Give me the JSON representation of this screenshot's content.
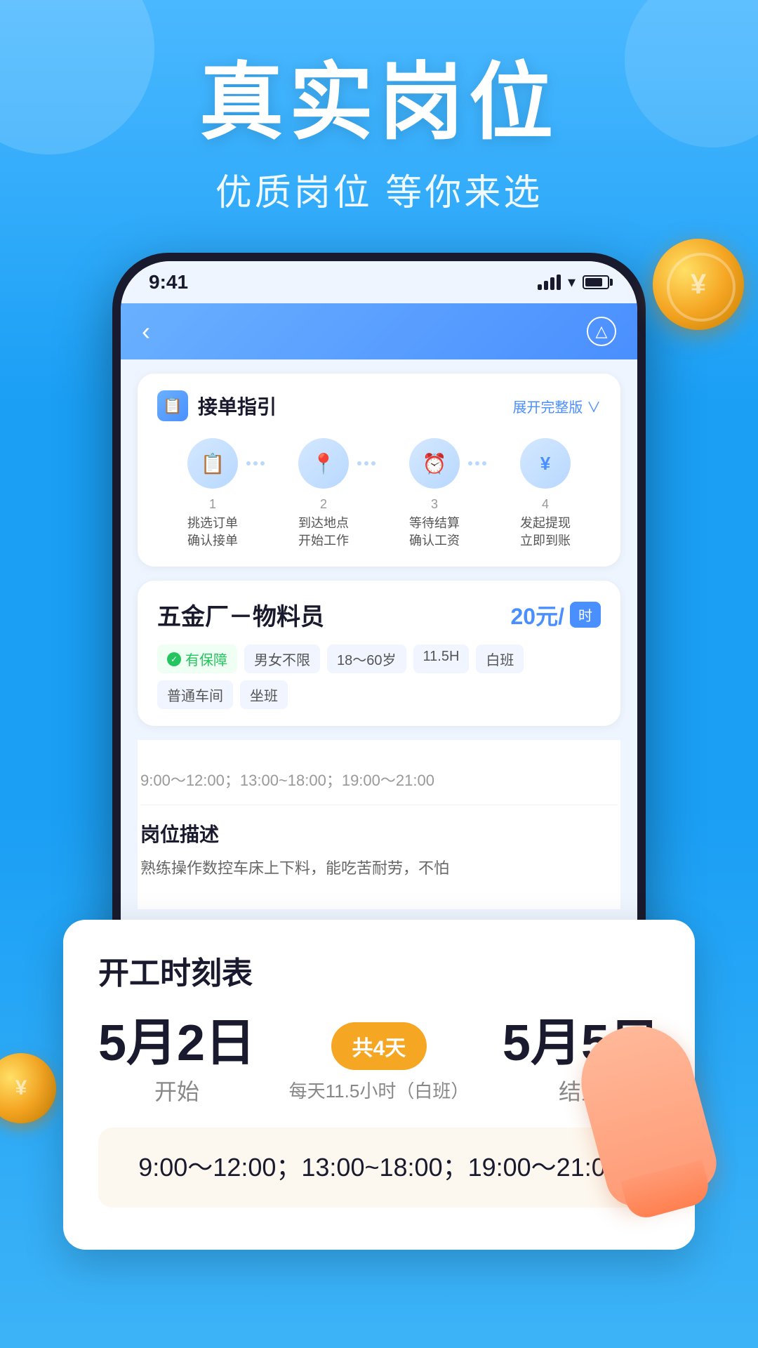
{
  "app": {
    "background_color": "#1a9ff5"
  },
  "header": {
    "main_title": "真实岗位",
    "sub_title": "优质岗位 等你来选"
  },
  "phone": {
    "status_bar": {
      "time": "9:41"
    },
    "guide_card": {
      "title": "接单指引",
      "expand_label": "展开完整版",
      "steps": [
        {
          "number": "1",
          "icon": "📋",
          "line1": "挑选订单",
          "line2": "确认接单"
        },
        {
          "number": "2",
          "icon": "📍",
          "line1": "到达地点",
          "line2": "开始工作"
        },
        {
          "number": "3",
          "icon": "⏰",
          "line1": "等待结算",
          "line2": "确认工资"
        },
        {
          "number": "4",
          "icon": "¥",
          "line1": "发起提现",
          "line2": "立即到账"
        }
      ]
    },
    "job_card": {
      "title": "五金厂－物料员",
      "wage": "20元/",
      "wage_unit": "时",
      "tags": [
        {
          "type": "green",
          "text": "有保障"
        },
        {
          "type": "default",
          "text": "男女不限"
        },
        {
          "type": "default",
          "text": "18～60岁"
        },
        {
          "type": "default",
          "text": "11.5H"
        },
        {
          "type": "default",
          "text": "白班"
        },
        {
          "type": "default",
          "text": "普通车间"
        },
        {
          "type": "default",
          "text": "坐班"
        }
      ]
    }
  },
  "schedule_popup": {
    "title": "开工时刻表",
    "start_date": "5月2日",
    "start_label": "开始",
    "end_date": "5月5日",
    "end_label": "结束",
    "days_badge": "共4天",
    "daily_desc": "每天11.5小时（白班）",
    "times_display": "9:00～12:00；13:00~18:00；19:00～21:00",
    "times_secondary": "9:00～12:00；13:00~18:00；19:00～21:00"
  },
  "job_description": {
    "section_title": "岗位描述",
    "description": "熟练操作数控车床上下料，能吃苦耐劳，不怕"
  }
}
